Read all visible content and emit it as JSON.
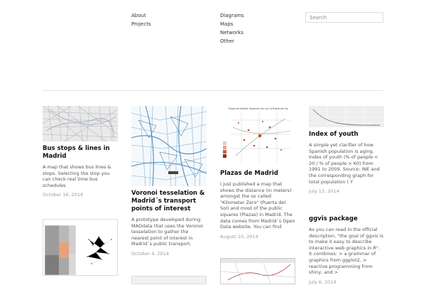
{
  "nav": {
    "left": [
      "About",
      "Projects"
    ],
    "right": [
      "Diagrams",
      "Maps",
      "Networks",
      "Other"
    ]
  },
  "search": {
    "placeholder": "Search"
  },
  "posts": [
    {
      "title": "Bus stops & lines in Madrid",
      "description": "A map that shows bus lines & stops. Selecting the stop you can check real time bus schedules",
      "date": "October 16, 2014"
    },
    {
      "title": "Voronoi tesselation & Madrid´s transport points of interest",
      "description": "A prototype developed during MADdata that uses the Voronoi tesselation to gather the nearest point of interest in Madrid´s public transport.",
      "date": "October 4, 2014"
    },
    {
      "title": "Plazas de Madrid",
      "description": "I just published a map that shows the distance (in meters) amongst the so called \"Kilometer Zero\" (Puerta del Sol) and most of the public squares (Plazas) in Madrid. The data comes from Madrid´s Open Data website. You can find",
      "date": "August 10, 2014",
      "thumb_caption": "Plazas de Madrid: distancia (m) con la Puerta del Sol"
    },
    {
      "title": "Index of youth",
      "description": "A simple yet clarifier of how Spanish population is aging. Index of youth (% of people < 20 / % of people > 60) from 1991 to 2009. Source: INE   and the corresponding graph for total population ( Y",
      "date": "July 13, 2014"
    },
    {
      "title": "ggvis package",
      "description": "As you can read in the official description, \"the goal of ggvis is to make it easy to describe interactive web graphics in R\". It combines: > a grammar of graphics from ggplot2, > reactive programming from shiny, and >",
      "date": "July 6, 2014"
    }
  ],
  "colors": {
    "accent_orange": "#e8a27a",
    "map_blue": "#4a90c8"
  }
}
